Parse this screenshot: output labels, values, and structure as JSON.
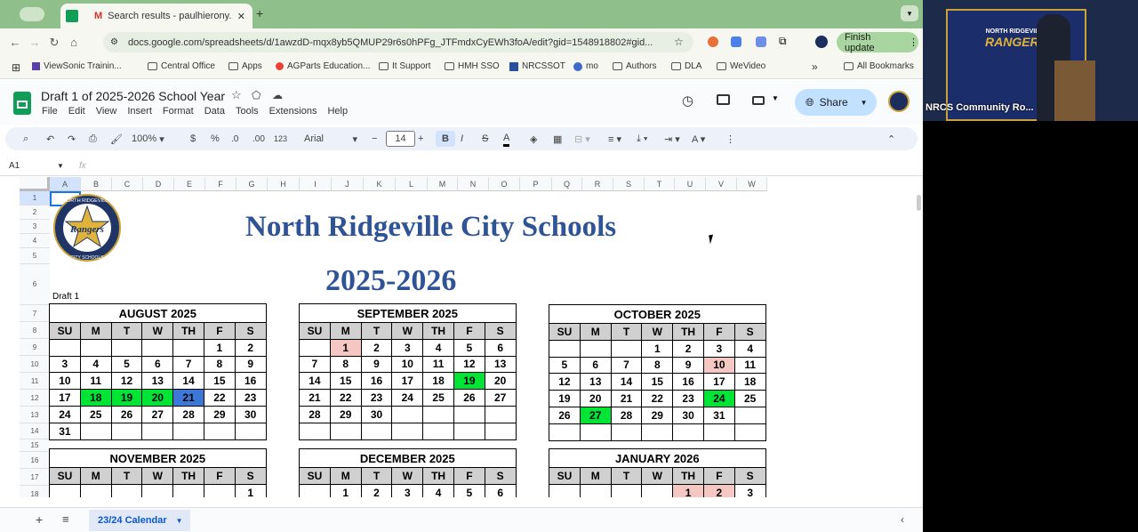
{
  "tabs": {
    "active_title": "Search results - paulhierony...",
    "close": "✕",
    "new": "+"
  },
  "address": {
    "url": "docs.google.com/spreadsheets/d/1awzdD-mqx8yb5QMUP29r6s0hPFg_JTFmdxCyEWh3foA/edit?gid=1548918802#gid...",
    "finish_update": "Finish update"
  },
  "bookmarks": [
    "ViewSonic Trainin...",
    "Central Office",
    "Apps",
    "AGParts Education...",
    "It Support",
    "HMH SSO",
    "NRCSSOT",
    "mo",
    "Authors",
    "DLA",
    "WeVideo"
  ],
  "bookmarks_more": "»",
  "all_bookmarks": "All Bookmarks",
  "doc": {
    "title": "Draft 1 of 2025-2026 School Year",
    "menus": [
      "File",
      "Edit",
      "View",
      "Insert",
      "Format",
      "Data",
      "Tools",
      "Extensions",
      "Help"
    ],
    "share": "Share"
  },
  "toolbar": {
    "zoom": "100%",
    "currency": "$",
    "percent": "%",
    "dec_minus": ".0",
    "dec_plus": ".00",
    "num_format": "123",
    "font": "Arial",
    "font_size": "14",
    "bold": "B",
    "italic": "I",
    "strike": "S",
    "text_color": "A"
  },
  "formula": {
    "cell_ref": "A1",
    "fx": "fx"
  },
  "columns": [
    "A",
    "B",
    "C",
    "D",
    "E",
    "F",
    "G",
    "H",
    "I",
    "J",
    "K",
    "L",
    "M",
    "N",
    "O",
    "P",
    "Q",
    "R",
    "S",
    "T",
    "U",
    "V",
    "W"
  ],
  "rows": [
    "1",
    "2",
    "3",
    "4",
    "5",
    "6",
    "7",
    "8",
    "9",
    "10",
    "11",
    "12",
    "13",
    "14",
    "15",
    "16",
    "17",
    "18"
  ],
  "sheet": {
    "school": "North Ridgeville City Schools",
    "year": "2025-2026",
    "draft": "Draft 1",
    "logo_top": "NORTH RIDGEVILLE",
    "logo_middle": "Rangers",
    "logo_bottom": "CITY SCHOOLS"
  },
  "days": [
    "SU",
    "M",
    "T",
    "W",
    "TH",
    "F",
    "S"
  ],
  "calendars": {
    "aug": {
      "title": "AUGUST 2025",
      "weeks": [
        [
          "",
          "",
          "",
          "",
          "",
          "1",
          "2"
        ],
        [
          "3",
          "4",
          "5",
          "6",
          "7",
          "8",
          "9"
        ],
        [
          "10",
          "11",
          "12",
          "13",
          "14",
          "15",
          "16"
        ],
        [
          "17",
          "18",
          "19",
          "20",
          "21",
          "22",
          "23"
        ],
        [
          "24",
          "25",
          "26",
          "27",
          "28",
          "29",
          "30"
        ],
        [
          "31",
          "",
          "",
          "",
          "",
          "",
          ""
        ]
      ]
    },
    "sep": {
      "title": "SEPTEMBER 2025",
      "weeks": [
        [
          "",
          "1",
          "2",
          "3",
          "4",
          "5",
          "6"
        ],
        [
          "7",
          "8",
          "9",
          "10",
          "11",
          "12",
          "13"
        ],
        [
          "14",
          "15",
          "16",
          "17",
          "18",
          "19",
          "20"
        ],
        [
          "21",
          "22",
          "23",
          "24",
          "25",
          "26",
          "27"
        ],
        [
          "28",
          "29",
          "30",
          "",
          "",
          "",
          ""
        ],
        [
          "",
          "",
          "",
          "",
          "",
          "",
          ""
        ]
      ]
    },
    "oct": {
      "title": "OCTOBER 2025",
      "weeks": [
        [
          "",
          "",
          "",
          "1",
          "2",
          "3",
          "4"
        ],
        [
          "5",
          "6",
          "7",
          "8",
          "9",
          "10",
          "11"
        ],
        [
          "12",
          "13",
          "14",
          "15",
          "16",
          "17",
          "18"
        ],
        [
          "19",
          "20",
          "21",
          "22",
          "23",
          "24",
          "25"
        ],
        [
          "26",
          "27",
          "28",
          "29",
          "30",
          "31",
          ""
        ],
        [
          "",
          "",
          "",
          "",
          "",
          "",
          ""
        ]
      ]
    },
    "nov": {
      "title": "NOVEMBER 2025",
      "weeks": [
        [
          "",
          "",
          "",
          "",
          "",
          "",
          "1"
        ]
      ]
    },
    "dec": {
      "title": "DECEMBER 2025",
      "weeks": [
        [
          "",
          "1",
          "2",
          "3",
          "4",
          "5",
          "6"
        ]
      ]
    },
    "jan": {
      "title": "JANUARY 2026",
      "weeks": [
        [
          "",
          "",
          "",
          "",
          "1",
          "2",
          "3"
        ]
      ]
    }
  },
  "bottom": {
    "sheet_tab": "23/24 Calendar"
  },
  "video": {
    "label": "NRCS Community Ro...",
    "banner_top": "NORTH RIDGEVILLE",
    "banner_main": "RANGERS"
  },
  "colors": {
    "green": "#00e436",
    "pink": "#f4c7c3",
    "blue": "#3c78d8",
    "title_blue": "#2f5496"
  }
}
